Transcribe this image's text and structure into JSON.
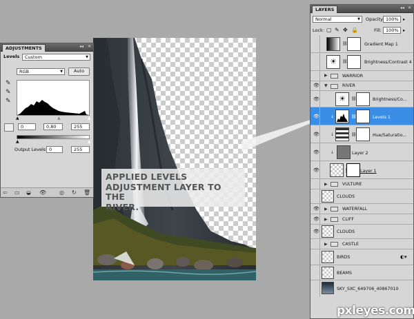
{
  "adjustments": {
    "tab_title": "ADJUSTMENTS",
    "preset_label": "Levels",
    "preset_value": "Custom",
    "channel_value": "RGB",
    "auto_label": "Auto",
    "input_black": "0",
    "input_gamma": "0,80",
    "input_white": "255",
    "output_label": "Output Levels:",
    "output_black": "0",
    "output_white": "255"
  },
  "layers": {
    "tab_title": "LAYERS",
    "blend_mode": "Normal",
    "opacity_label": "Opacity:",
    "opacity_value": "100%",
    "lock_label": "Lock:",
    "fill_label": "Fill:",
    "fill_value": "100%",
    "items": [
      {
        "name": "Gradient Map 1",
        "kind": "adjustment"
      },
      {
        "name": "Brightness/Contrast 4",
        "kind": "adjustment"
      },
      {
        "name": "WARRIOR",
        "kind": "group"
      },
      {
        "name": "RIVER",
        "kind": "group-open"
      },
      {
        "name": "Brightness/Co...",
        "kind": "adjustment"
      },
      {
        "name": "Levels 1",
        "kind": "adjustment",
        "selected": true
      },
      {
        "name": "Hue/Saturatio...",
        "kind": "adjustment"
      },
      {
        "name": "Layer 2",
        "kind": "layer"
      },
      {
        "name": "Layer 1",
        "kind": "layer"
      },
      {
        "name": "VULTURE",
        "kind": "group"
      },
      {
        "name": "CLOUDS",
        "kind": "layer"
      },
      {
        "name": "WATERFALL",
        "kind": "group"
      },
      {
        "name": "CLIFF",
        "kind": "group"
      },
      {
        "name": "CLOUDS",
        "kind": "layer"
      },
      {
        "name": "CASTLE",
        "kind": "group"
      },
      {
        "name": "BIRDS",
        "kind": "layer"
      },
      {
        "name": "BEAMS",
        "kind": "layer"
      },
      {
        "name": "SKY_SXC_649706_40867010",
        "kind": "layer"
      }
    ]
  },
  "callout": {
    "text": "APPLIED LEVELS\nADJUSTMENT LAYER TO THE\nRIVER."
  },
  "watermark": "pxleyes.com",
  "colors": {
    "selection": "#3a8ee6",
    "panel": "#d6d6d6",
    "workspace": "#a9a9a9"
  }
}
